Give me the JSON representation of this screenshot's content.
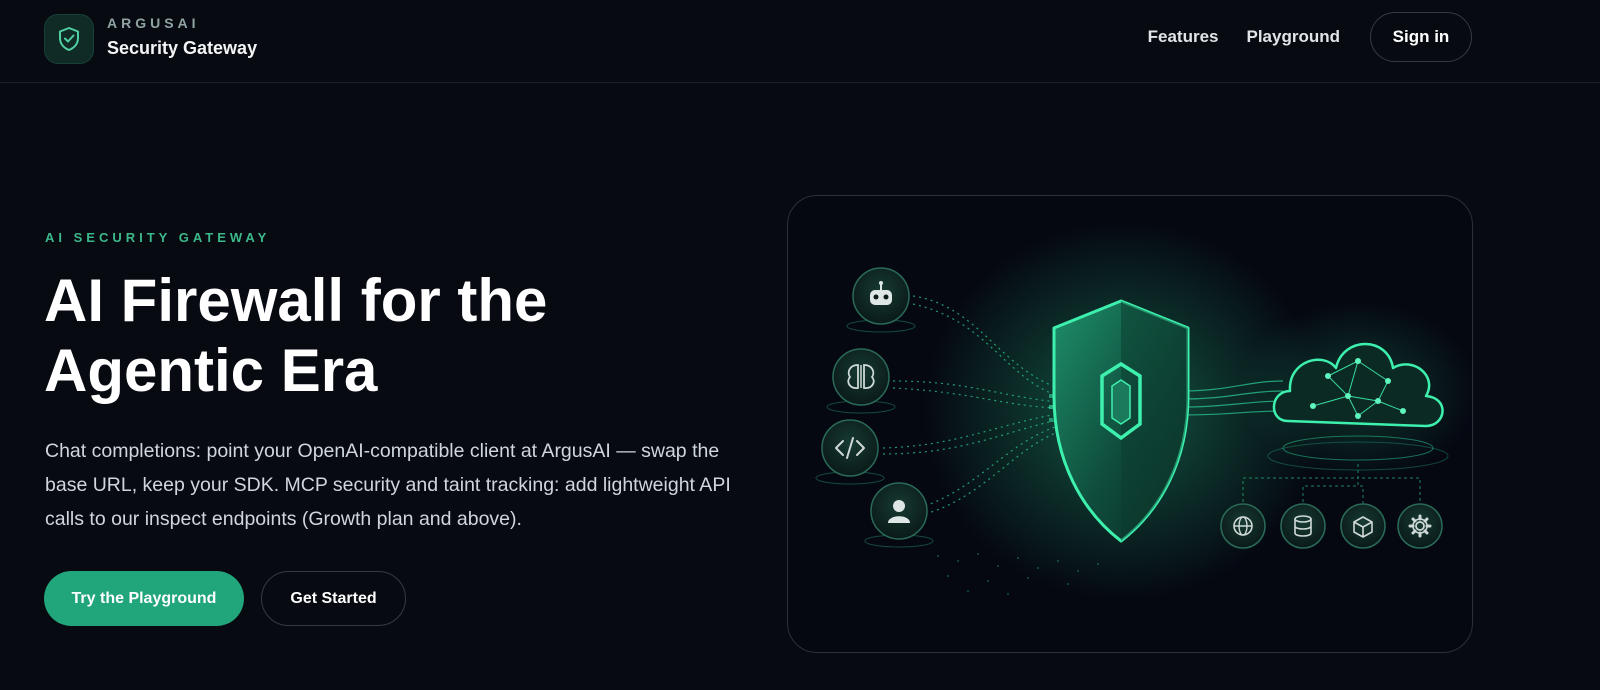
{
  "header": {
    "brand_small": "ARGUSAI",
    "brand_name": "Security Gateway",
    "nav": {
      "features": "Features",
      "playground": "Playground",
      "signin": "Sign in"
    }
  },
  "hero": {
    "eyebrow": "AI SECURITY GATEWAY",
    "title_line1": "AI Firewall for the",
    "title_line2": "Agentic Era",
    "description": "Chat completions: point your OpenAI-compatible client at ArgusAI — swap the base URL, keep your SDK. MCP security and taint tracking: add lightweight API calls to our inspect endpoints (Growth plan and above).",
    "primary_cta": "Try the Playground",
    "secondary_cta": "Get Started"
  },
  "illustration": {
    "left_icons": [
      "robot-icon",
      "brain-icon",
      "code-icon",
      "user-icon"
    ],
    "center_icon": "shield-icon",
    "right_icon": "cloud-network-icon",
    "bottom_icons": [
      "globe-icon",
      "database-icon",
      "cube-icon",
      "gear-icon"
    ]
  },
  "colors": {
    "background": "#080a12",
    "accent": "#21a57b",
    "accent_light": "#3bb98a",
    "glow": "#2ee6a0"
  }
}
